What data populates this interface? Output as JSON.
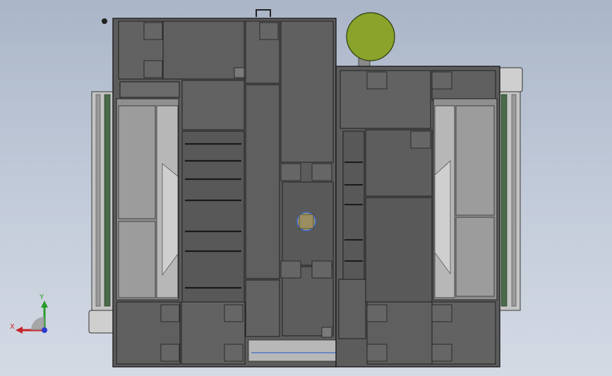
{
  "viewport": {
    "name": "cad-3d-viewport",
    "background_top": "#aab6c8",
    "background_bottom": "#d4dae4"
  },
  "model": {
    "description_icon": "machine-assembly-top-view",
    "body_color": "#5a5a5a",
    "panel_color": "#606060",
    "edge_color": "#1e1e1e",
    "frame_color": "#8a8a8a",
    "glass_color": "#9c9c9c",
    "light_color": "#c8c8c8",
    "sphere_color": "#8aa32b",
    "hub_color": "#a89a6a",
    "hub_ring_color": "#3a6cc8"
  },
  "triad": {
    "x_label": "X",
    "y_label": "Y",
    "x_color": "#c8252a",
    "y_color": "#2a9a2a",
    "z_color": "#2a3ad0"
  }
}
